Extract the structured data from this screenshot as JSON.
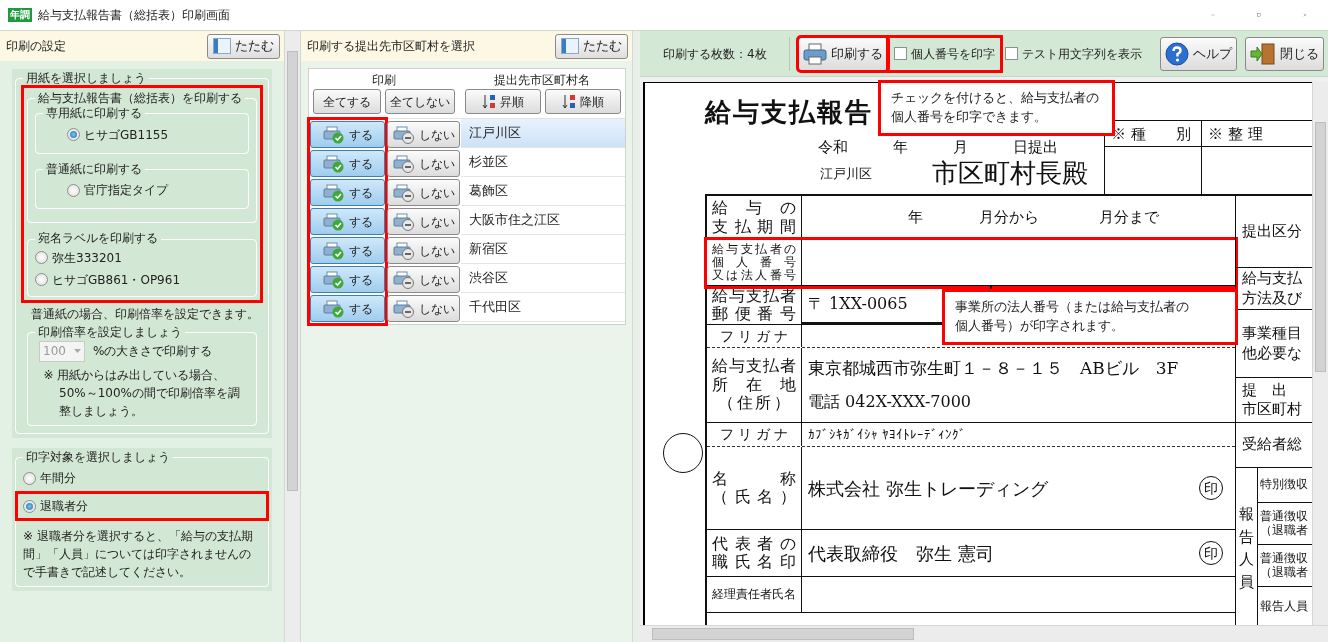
{
  "window": {
    "title": "給与支払報告書（総括表）印刷画面",
    "app_icon": "年調"
  },
  "settings": {
    "title": "印刷の設定",
    "collapse_button": "たたむ",
    "paper_group": {
      "legend": "用紙を選択しましょう",
      "highlighted": true,
      "report_group": {
        "legend": "給与支払報告書（総括表）を印刷する",
        "subgroups": [
          {
            "legend": "専用紙に印刷する",
            "options": [
              {
                "label": "ヒサゴGB1155",
                "selected": true
              }
            ]
          },
          {
            "legend": "普通紙に印刷する",
            "options": [
              {
                "label": "官庁指定タイプ",
                "selected": false
              }
            ]
          }
        ]
      },
      "label_group": {
        "legend": "宛名ラベルを印刷する",
        "options": [
          {
            "label": "弥生333201",
            "selected": false
          },
          {
            "label": "ヒサゴGB861・OP961",
            "selected": false
          }
        ]
      },
      "note": "普通紙の場合、印刷倍率を設定できます。",
      "scale_group": {
        "legend": "印刷倍率を設定しましょう",
        "value": "100",
        "disabled": true,
        "suffix": "%の大きさで印刷する",
        "note": "※ 用紙からはみ出している場合、50%～100%の間で印刷倍率を調整しましょう。"
      }
    },
    "target_group": {
      "legend": "印字対象を選択しましょう",
      "options": [
        {
          "label": "年間分",
          "selected": false,
          "highlighted": false
        },
        {
          "label": "退職者分",
          "selected": true,
          "highlighted": true
        }
      ],
      "note": "※ 退職者分を選択すると、「給与の支払期間」「人員」については印字されませんので手書きで記述してください。"
    }
  },
  "cities": {
    "title": "印刷する提出先市区町村を選択",
    "collapse_button": "たたむ",
    "columns": [
      "印刷",
      "提出先市区町村名"
    ],
    "bulk_buttons": [
      "全てする",
      "全てしない"
    ],
    "sort_buttons": [
      {
        "label": "昇順",
        "kind": "ascending"
      },
      {
        "label": "降順",
        "kind": "descending"
      }
    ],
    "print_column_highlighted": true,
    "rows": [
      {
        "print_label": "する",
        "skip_label": "しない",
        "print": true,
        "name": "江戸川区",
        "selected": true
      },
      {
        "print_label": "する",
        "skip_label": "しない",
        "print": true,
        "name": "杉並区",
        "selected": false
      },
      {
        "print_label": "する",
        "skip_label": "しない",
        "print": true,
        "name": "葛飾区",
        "selected": false
      },
      {
        "print_label": "する",
        "skip_label": "しない",
        "print": true,
        "name": "大阪市住之江区",
        "selected": false
      },
      {
        "print_label": "する",
        "skip_label": "しない",
        "print": true,
        "name": "新宿区",
        "selected": false
      },
      {
        "print_label": "する",
        "skip_label": "しない",
        "print": true,
        "name": "渋谷区",
        "selected": false
      },
      {
        "print_label": "する",
        "skip_label": "しない",
        "print": true,
        "name": "千代田区",
        "selected": false
      }
    ]
  },
  "preview": {
    "toolbar": {
      "page_count": "印刷する枚数：4枚",
      "print_button": {
        "label": "印刷する",
        "highlighted": true
      },
      "checkboxes": [
        {
          "label": "個人番号を印字",
          "checked": false,
          "highlighted": true
        },
        {
          "label": "テスト用文字列を表示",
          "checked": false,
          "highlighted": false
        }
      ],
      "buttons": [
        {
          "label": "ヘルプ",
          "kind": "help"
        },
        {
          "label": "閉じる",
          "kind": "close"
        }
      ]
    },
    "tooltips": [
      "チェックを付けると、給与支払者の個人番号を印字できます。",
      "事業所の法人番号（または給与支払者の個人番号）が印字されます。"
    ],
    "document": {
      "title": "給与支払報告",
      "date_line": "令和　　　年　　　月　　　日提出",
      "city": "江戸川区",
      "addressee": "市区町村長殿",
      "ref_boxes": [
        "※ 種　　別",
        "※ 整 理"
      ],
      "rows": [
        {
          "kind": "period",
          "label_lines": [
            "給与の",
            "支払期間"
          ],
          "parts": [
            "年",
            "月分から",
            "月分まで"
          ]
        },
        {
          "kind": "blank",
          "label_lines": [
            "給与支払者の",
            "個人番号",
            "又は法人番号"
          ],
          "highlighted": true
        },
        {
          "kind": "postal",
          "label_lines": [
            "給与支払者",
            "郵便番号"
          ],
          "value": "〒 1XX-0065"
        },
        {
          "kind": "kana",
          "label_lines": [
            "フリガナ"
          ]
        },
        {
          "kind": "address",
          "label_lines": [
            "給与支払者",
            "所在地",
            "（住所）"
          ],
          "lines": [
            "東京都城西市弥生町１－８－１５　ABビル　3F",
            "電話 042X-XXX-7000"
          ]
        },
        {
          "kind": "kana",
          "label_lines": [
            "フリガナ"
          ],
          "value": "ｶﾌﾞｼｷｶﾞｲｼｬ ﾔﾖｲﾄﾚｰﾃﾞｨﾝｸﾞ"
        },
        {
          "kind": "text",
          "label_lines": [
            "名　称",
            "（氏名）"
          ],
          "value": "株式会社 弥生トレーディング",
          "seal": "印"
        },
        {
          "kind": "text",
          "label_lines": [
            "代表者の",
            "職氏名印"
          ],
          "value": "代表取締役　弥生 憲司",
          "seal": "印"
        },
        {
          "kind": "text",
          "label_lines": [
            "経理責任者氏名"
          ]
        }
      ],
      "side_cells": [
        {
          "kind": "cell",
          "lines": [
            "提出区分"
          ]
        },
        {
          "kind": "cell",
          "lines": [
            "給与支払",
            "方法及び"
          ]
        },
        {
          "kind": "cell",
          "lines": [
            "事業種目",
            "他必要な"
          ]
        },
        {
          "kind": "cell",
          "lines": [
            "提　出",
            "市区町村"
          ]
        },
        {
          "kind": "cell",
          "lines": [
            "受給者総"
          ]
        },
        {
          "kind": "group",
          "label": "報告人員",
          "children": [
            {
              "lines": [
                "特別徴収"
              ]
            },
            {
              "lines": [
                "普通徴収",
                "（退職者"
              ]
            },
            {
              "lines": [
                "普通徴収",
                "（退職者"
              ]
            },
            {
              "lines": [
                "報告人員"
              ]
            }
          ]
        }
      ]
    }
  }
}
